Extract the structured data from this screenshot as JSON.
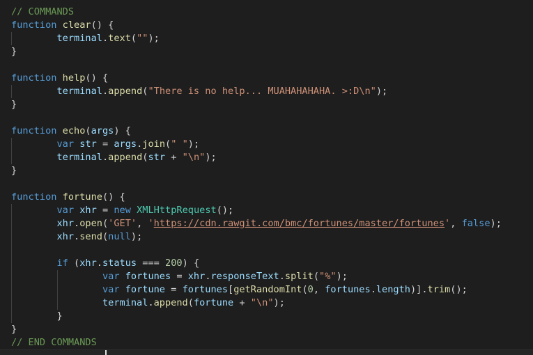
{
  "editor": {
    "lines": [
      [
        {
          "t": "// COMMANDS",
          "c": "comment"
        }
      ],
      [
        {
          "t": "function",
          "c": "keyword"
        },
        {
          "t": " ",
          "c": "punct"
        },
        {
          "t": "clear",
          "c": "function"
        },
        {
          "t": "() {",
          "c": "punct"
        }
      ],
      [
        {
          "t": "        ",
          "c": "punct"
        },
        {
          "t": "terminal",
          "c": "variable"
        },
        {
          "t": ".",
          "c": "punct"
        },
        {
          "t": "text",
          "c": "function"
        },
        {
          "t": "(",
          "c": "punct"
        },
        {
          "t": "\"\"",
          "c": "string"
        },
        {
          "t": ");",
          "c": "punct"
        }
      ],
      [
        {
          "t": "}",
          "c": "punct"
        }
      ],
      [],
      [
        {
          "t": "function",
          "c": "keyword"
        },
        {
          "t": " ",
          "c": "punct"
        },
        {
          "t": "help",
          "c": "function"
        },
        {
          "t": "() {",
          "c": "punct"
        }
      ],
      [
        {
          "t": "        ",
          "c": "punct"
        },
        {
          "t": "terminal",
          "c": "variable"
        },
        {
          "t": ".",
          "c": "punct"
        },
        {
          "t": "append",
          "c": "function"
        },
        {
          "t": "(",
          "c": "punct"
        },
        {
          "t": "\"There is no help... MUAHAHAHAHA. >:D\\n\"",
          "c": "string"
        },
        {
          "t": ");",
          "c": "punct"
        }
      ],
      [
        {
          "t": "}",
          "c": "punct"
        }
      ],
      [],
      [
        {
          "t": "function",
          "c": "keyword"
        },
        {
          "t": " ",
          "c": "punct"
        },
        {
          "t": "echo",
          "c": "function"
        },
        {
          "t": "(",
          "c": "punct"
        },
        {
          "t": "args",
          "c": "variable"
        },
        {
          "t": ") {",
          "c": "punct"
        }
      ],
      [
        {
          "t": "        ",
          "c": "punct"
        },
        {
          "t": "var",
          "c": "keyword"
        },
        {
          "t": " ",
          "c": "punct"
        },
        {
          "t": "str",
          "c": "variable"
        },
        {
          "t": " = ",
          "c": "punct"
        },
        {
          "t": "args",
          "c": "variable"
        },
        {
          "t": ".",
          "c": "punct"
        },
        {
          "t": "join",
          "c": "function"
        },
        {
          "t": "(",
          "c": "punct"
        },
        {
          "t": "\" \"",
          "c": "string"
        },
        {
          "t": ");",
          "c": "punct"
        }
      ],
      [
        {
          "t": "        ",
          "c": "punct"
        },
        {
          "t": "terminal",
          "c": "variable"
        },
        {
          "t": ".",
          "c": "punct"
        },
        {
          "t": "append",
          "c": "function"
        },
        {
          "t": "(",
          "c": "punct"
        },
        {
          "t": "str",
          "c": "variable"
        },
        {
          "t": " + ",
          "c": "punct"
        },
        {
          "t": "\"\\n\"",
          "c": "string"
        },
        {
          "t": ");",
          "c": "punct"
        }
      ],
      [
        {
          "t": "}",
          "c": "punct"
        }
      ],
      [],
      [
        {
          "t": "function",
          "c": "keyword"
        },
        {
          "t": " ",
          "c": "punct"
        },
        {
          "t": "fortune",
          "c": "function"
        },
        {
          "t": "() {",
          "c": "punct"
        }
      ],
      [
        {
          "t": "        ",
          "c": "punct"
        },
        {
          "t": "var",
          "c": "keyword"
        },
        {
          "t": " ",
          "c": "punct"
        },
        {
          "t": "xhr",
          "c": "variable"
        },
        {
          "t": " = ",
          "c": "punct"
        },
        {
          "t": "new",
          "c": "keyword"
        },
        {
          "t": " ",
          "c": "punct"
        },
        {
          "t": "XMLHttpRequest",
          "c": "class"
        },
        {
          "t": "();",
          "c": "punct"
        }
      ],
      [
        {
          "t": "        ",
          "c": "punct"
        },
        {
          "t": "xhr",
          "c": "variable"
        },
        {
          "t": ".",
          "c": "punct"
        },
        {
          "t": "open",
          "c": "function"
        },
        {
          "t": "(",
          "c": "punct"
        },
        {
          "t": "'GET'",
          "c": "string"
        },
        {
          "t": ", ",
          "c": "punct"
        },
        {
          "t": "'",
          "c": "string"
        },
        {
          "t": "https://cdn.rawgit.com/bmc/fortunes/master/fortunes",
          "c": "link"
        },
        {
          "t": "'",
          "c": "string"
        },
        {
          "t": ", ",
          "c": "punct"
        },
        {
          "t": "false",
          "c": "keyword"
        },
        {
          "t": ");",
          "c": "punct"
        }
      ],
      [
        {
          "t": "        ",
          "c": "punct"
        },
        {
          "t": "xhr",
          "c": "variable"
        },
        {
          "t": ".",
          "c": "punct"
        },
        {
          "t": "send",
          "c": "function"
        },
        {
          "t": "(",
          "c": "punct"
        },
        {
          "t": "null",
          "c": "keyword"
        },
        {
          "t": ");",
          "c": "punct"
        }
      ],
      [],
      [
        {
          "t": "        ",
          "c": "punct"
        },
        {
          "t": "if",
          "c": "keyword"
        },
        {
          "t": " (",
          "c": "punct"
        },
        {
          "t": "xhr",
          "c": "variable"
        },
        {
          "t": ".",
          "c": "punct"
        },
        {
          "t": "status",
          "c": "variable"
        },
        {
          "t": " === ",
          "c": "punct"
        },
        {
          "t": "200",
          "c": "number"
        },
        {
          "t": ") {",
          "c": "punct"
        }
      ],
      [
        {
          "t": "                ",
          "c": "punct"
        },
        {
          "t": "var",
          "c": "keyword"
        },
        {
          "t": " ",
          "c": "punct"
        },
        {
          "t": "fortunes",
          "c": "variable"
        },
        {
          "t": " = ",
          "c": "punct"
        },
        {
          "t": "xhr",
          "c": "variable"
        },
        {
          "t": ".",
          "c": "punct"
        },
        {
          "t": "responseText",
          "c": "variable"
        },
        {
          "t": ".",
          "c": "punct"
        },
        {
          "t": "split",
          "c": "function"
        },
        {
          "t": "(",
          "c": "punct"
        },
        {
          "t": "\"%\"",
          "c": "string"
        },
        {
          "t": ");",
          "c": "punct"
        }
      ],
      [
        {
          "t": "                ",
          "c": "punct"
        },
        {
          "t": "var",
          "c": "keyword"
        },
        {
          "t": " ",
          "c": "punct"
        },
        {
          "t": "fortune",
          "c": "variable"
        },
        {
          "t": " = ",
          "c": "punct"
        },
        {
          "t": "fortunes",
          "c": "variable"
        },
        {
          "t": "[",
          "c": "punct"
        },
        {
          "t": "getRandomInt",
          "c": "function"
        },
        {
          "t": "(",
          "c": "punct"
        },
        {
          "t": "0",
          "c": "number"
        },
        {
          "t": ", ",
          "c": "punct"
        },
        {
          "t": "fortunes",
          "c": "variable"
        },
        {
          "t": ".",
          "c": "punct"
        },
        {
          "t": "length",
          "c": "variable"
        },
        {
          "t": ")].",
          "c": "punct"
        },
        {
          "t": "trim",
          "c": "function"
        },
        {
          "t": "();",
          "c": "punct"
        }
      ],
      [
        {
          "t": "                ",
          "c": "punct"
        },
        {
          "t": "terminal",
          "c": "variable"
        },
        {
          "t": ".",
          "c": "punct"
        },
        {
          "t": "append",
          "c": "function"
        },
        {
          "t": "(",
          "c": "punct"
        },
        {
          "t": "fortune",
          "c": "variable"
        },
        {
          "t": " + ",
          "c": "punct"
        },
        {
          "t": "\"\\n\"",
          "c": "string"
        },
        {
          "t": ");",
          "c": "punct"
        }
      ],
      [
        {
          "t": "        ",
          "c": "punct"
        },
        {
          "t": "}",
          "c": "punct"
        }
      ],
      [
        {
          "t": "}",
          "c": "punct"
        }
      ],
      [
        {
          "t": "// END COMMANDS",
          "c": "comment"
        }
      ]
    ],
    "indent_levels": [
      0,
      0,
      1,
      0,
      0,
      0,
      1,
      0,
      0,
      0,
      1,
      1,
      0,
      0,
      0,
      1,
      1,
      1,
      1,
      1,
      2,
      2,
      2,
      1,
      0,
      0
    ]
  },
  "colors": {
    "background": "#1e1e1e",
    "comment": "#6a9955",
    "keyword": "#569cd6",
    "function": "#dcdcaa",
    "variable": "#9cdcfe",
    "string": "#ce9178",
    "number": "#b5cea8",
    "class": "#4ec9b0"
  }
}
